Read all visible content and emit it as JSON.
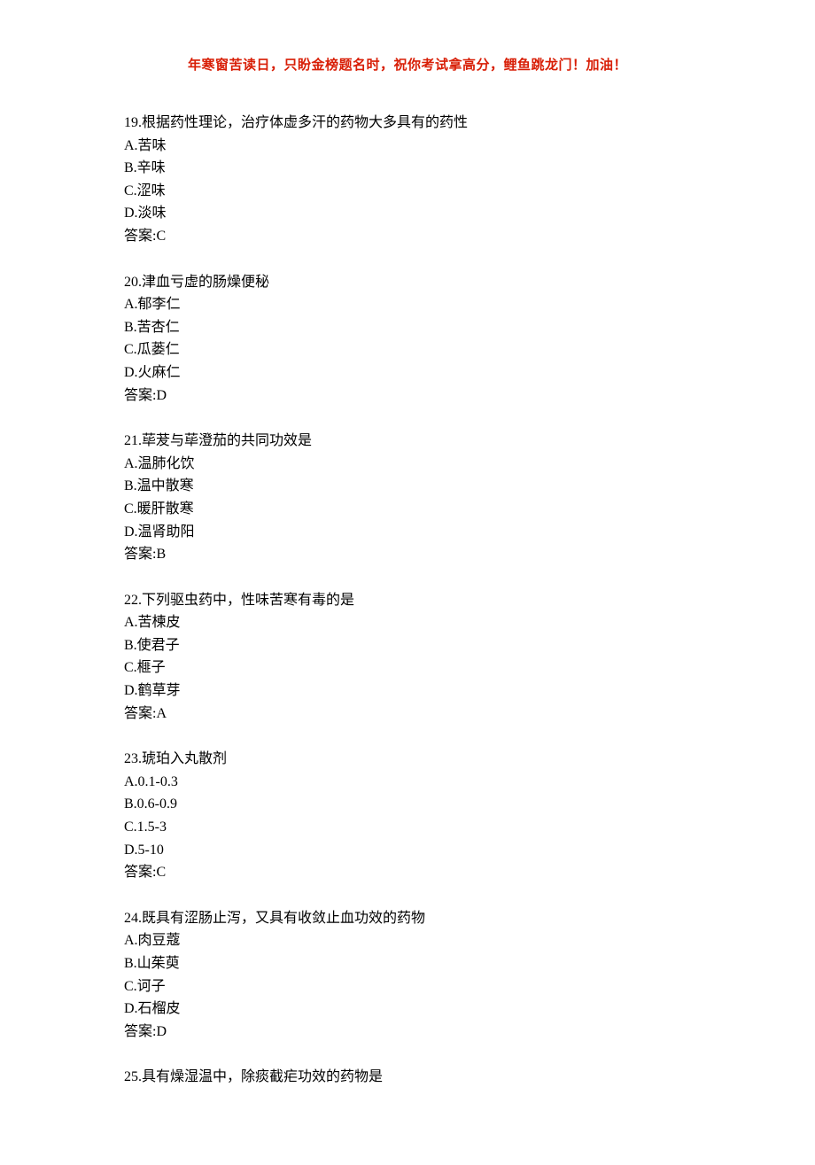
{
  "header": "年寒窗苦读日，只盼金榜题名时，祝你考试拿高分，鲤鱼跳龙门！加油！",
  "questions": [
    {
      "num": "19",
      "text": "根据药性理论，治疗体虚多汗的药物大多具有的药性",
      "options": [
        {
          "label": "A",
          "text": "苦味"
        },
        {
          "label": "B",
          "text": "辛味"
        },
        {
          "label": "C",
          "text": "涩味"
        },
        {
          "label": "D",
          "text": "淡味"
        }
      ],
      "answer": "C"
    },
    {
      "num": "20",
      "text": "津血亏虚的肠燥便秘",
      "options": [
        {
          "label": "A",
          "text": "郁李仁"
        },
        {
          "label": "B",
          "text": "苦杏仁"
        },
        {
          "label": "C",
          "text": "瓜蒌仁"
        },
        {
          "label": "D",
          "text": "火麻仁"
        }
      ],
      "answer": "D"
    },
    {
      "num": "21",
      "text": "荜茇与荜澄茄的共同功效是",
      "options": [
        {
          "label": "A",
          "text": "温肺化饮"
        },
        {
          "label": "B",
          "text": "温中散寒"
        },
        {
          "label": "C",
          "text": "暖肝散寒"
        },
        {
          "label": "D",
          "text": "温肾助阳"
        }
      ],
      "answer": "B"
    },
    {
      "num": "22",
      "text": "下列驱虫药中，性味苦寒有毒的是",
      "options": [
        {
          "label": "A",
          "text": "苦楝皮"
        },
        {
          "label": "B",
          "text": "使君子"
        },
        {
          "label": "C",
          "text": "榧子"
        },
        {
          "label": "D",
          "text": "鹤草芽"
        }
      ],
      "answer": "A"
    },
    {
      "num": "23",
      "text": "琥珀入丸散剂",
      "options": [
        {
          "label": "A",
          "text": "0.1-0.3"
        },
        {
          "label": "B",
          "text": "0.6-0.9"
        },
        {
          "label": "C",
          "text": "1.5-3"
        },
        {
          "label": "D",
          "text": "5-10"
        }
      ],
      "answer": "C"
    },
    {
      "num": "24",
      "text": "既具有涩肠止泻，又具有收敛止血功效的药物",
      "options": [
        {
          "label": "A",
          "text": "肉豆蔻"
        },
        {
          "label": "B",
          "text": "山茱萸"
        },
        {
          "label": "C",
          "text": "诃子"
        },
        {
          "label": "D",
          "text": "石榴皮"
        }
      ],
      "answer": "D"
    },
    {
      "num": "25",
      "text": "具有燥湿温中，除痰截疟功效的药物是",
      "options": [],
      "answer": null
    }
  ],
  "labels": {
    "answer_prefix": "答案:"
  }
}
